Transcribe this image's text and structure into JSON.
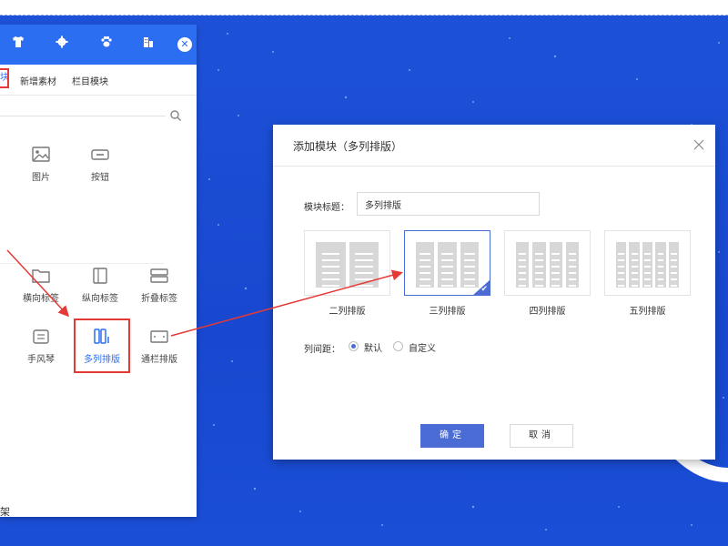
{
  "panel": {
    "tabs": {
      "active": "块",
      "new_material": "新增素材",
      "column_module": "栏目模块"
    },
    "items": [
      {
        "label": "图片"
      },
      {
        "label": "按钮"
      },
      {
        "label": "横向标签"
      },
      {
        "label": "纵向标签"
      },
      {
        "label": "折叠标签"
      },
      {
        "label": "手风琴"
      },
      {
        "label": "多列排版"
      },
      {
        "label": "通栏排版"
      }
    ],
    "bottom_text": "架"
  },
  "dialog": {
    "title": "添加模块（多列排版）",
    "title_field_label": "模块标题：",
    "title_field_value": "多列排版",
    "layouts": [
      {
        "label": "二列排版",
        "columns": 2,
        "selected": false
      },
      {
        "label": "三列排版",
        "columns": 3,
        "selected": true
      },
      {
        "label": "四列排版",
        "columns": 4,
        "selected": false
      },
      {
        "label": "五列排版",
        "columns": 5,
        "selected": false
      }
    ],
    "spacing_label": "列间距：",
    "spacing_options": [
      {
        "label": "默认",
        "selected": true
      },
      {
        "label": "自定义",
        "selected": false
      }
    ],
    "ok_label": "确定",
    "cancel_label": "取消"
  },
  "colors": {
    "background": "#1a4ed6",
    "panel_header": "#2c6ef2",
    "accent": "#4a6cd4",
    "highlight": "#e53935"
  }
}
